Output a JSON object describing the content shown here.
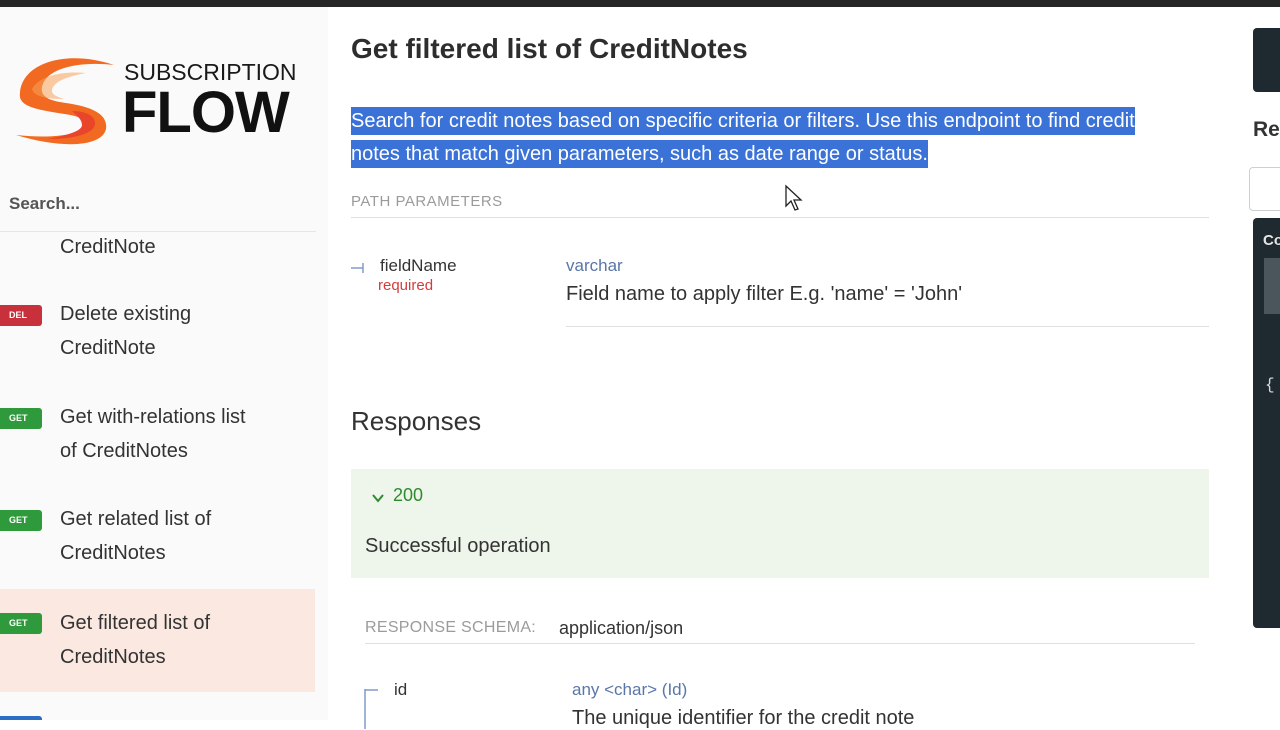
{
  "brand": {
    "sub": "SUBSCRIPTION",
    "main": "FLOW",
    "mark_colors": [
      "#f26a21",
      "#e8452a"
    ]
  },
  "sidebar": {
    "search_placeholder": "Search...",
    "items": [
      {
        "badge": "",
        "label_lines": [
          "",
          "CreditNote"
        ]
      },
      {
        "badge": "DEL",
        "badge_color": "#c8313c",
        "label_lines": [
          "Delete existing",
          "CreditNote"
        ]
      },
      {
        "badge": "GET",
        "badge_color": "#2e9a3c",
        "label_lines": [
          "Get with-relations list",
          "of CreditNotes"
        ]
      },
      {
        "badge": "GET",
        "badge_color": "#2e9a3c",
        "label_lines": [
          "Get related list of",
          "CreditNotes"
        ]
      },
      {
        "badge": "GET",
        "badge_color": "#2e9a3c",
        "label_lines": [
          "Get filtered list of",
          "CreditNotes"
        ],
        "active": true
      }
    ]
  },
  "main": {
    "title": "Get filtered list of CreditNotes",
    "description": "Search for credit notes based on specific criteria or filters. Use this endpoint to find credit notes that match given parameters, such as date range or status.",
    "path_params_label": "PATH PARAMETERS",
    "params": [
      {
        "name": "fieldName",
        "required": "required",
        "type": "varchar",
        "description": "Field name to apply filter E.g. 'name' = 'John'"
      }
    ],
    "responses_heading": "Responses",
    "responses": [
      {
        "code": "200",
        "description": "Successful operation",
        "color": "#2e8b2e"
      }
    ],
    "schema_label": "RESPONSE SCHEMA:",
    "schema_type": "application/json",
    "schema_fields": [
      {
        "name": "id",
        "type": "any <char> (Id)",
        "description": "The unique identifier for the credit note"
      }
    ]
  },
  "right_panel": {
    "title": "Re",
    "panel_label": "Co",
    "brace": "{"
  },
  "colors": {
    "selection": "#3a72d8",
    "active_item_bg": "#fbe9e1",
    "response_bg": "#eef5ea",
    "dark_panel": "#1f2a30"
  }
}
